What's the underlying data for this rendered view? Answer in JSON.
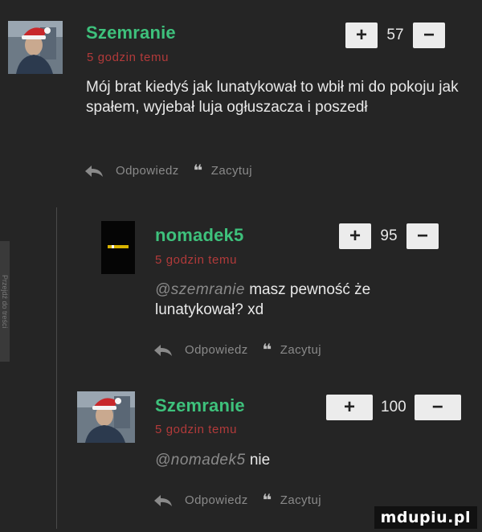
{
  "side_tab": {
    "label": "Przejdź do treści"
  },
  "comments": [
    {
      "username": "Szemranie",
      "time": "5 godzin temu",
      "body": "Mój brat kiedyś jak lunatykował to wbił mi do pokoju jak spałem, wyjebał luja ogłuszacza i poszedł",
      "mention": "",
      "score": "57",
      "upvote_label": "+",
      "downvote_label": "−",
      "reply_label": "Odpowiedz",
      "quote_label": "Zacytuj"
    },
    {
      "username": "nomadek5",
      "time": "5 godzin temu",
      "mention": "@szemranie",
      "body": "masz pewność że lunatykował? xd",
      "score": "95",
      "upvote_label": "+",
      "downvote_label": "−",
      "reply_label": "Odpowiedz",
      "quote_label": "Zacytuj"
    },
    {
      "username": "Szemranie",
      "time": "5 godzin temu",
      "mention": "@nomadek5",
      "body": "nie",
      "score": "100",
      "upvote_label": "+",
      "downvote_label": "−",
      "reply_label": "Odpowiedz",
      "quote_label": "Zacytuj"
    }
  ],
  "watermark": {
    "text": "mdupiu.pl"
  },
  "colors": {
    "username": "#3ec17c",
    "time": "#b23a3a",
    "background": "#252525",
    "vote_button": "#ececec"
  },
  "icons": {
    "reply": "reply-arrow-icon",
    "quote": "quote-icon",
    "avatar_hat": "santa-hat-icon"
  }
}
